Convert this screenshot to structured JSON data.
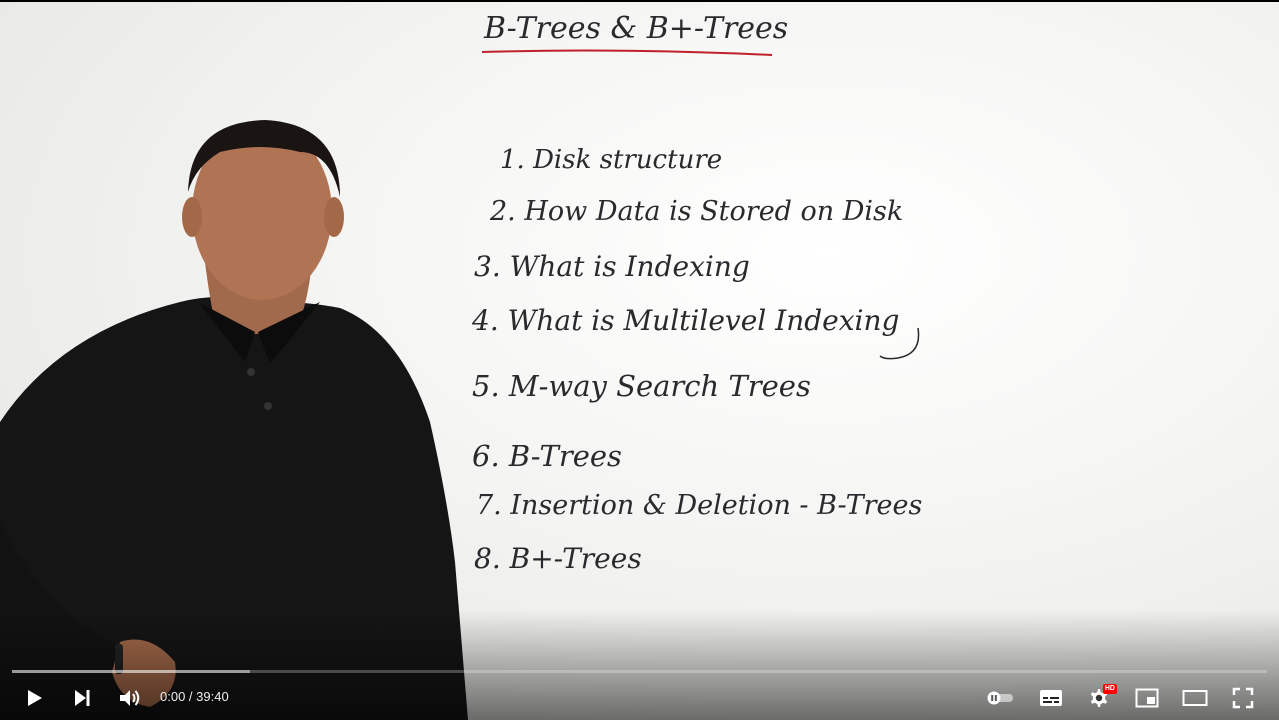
{
  "whiteboard": {
    "title": "B-Trees & B+-Trees",
    "items": [
      "1. Disk structure",
      "2. How Data is Stored on Disk",
      "3. What is Indexing",
      "4. What is Multilevel Indexing",
      "5. M-way Search Trees",
      "6. B-Trees",
      "7. Insertion & Deletion - B-Trees",
      "8. B+-Trees"
    ]
  },
  "player": {
    "current_time": "0:00",
    "separator": " / ",
    "duration": "39:40",
    "hd_badge": "HD",
    "progress_played": 0.0,
    "progress_loaded": 0.19,
    "autoplay_state": "off",
    "accent_color": "#ff0000"
  },
  "controls": {
    "icons": [
      "play-icon",
      "next-icon",
      "volume-icon",
      "autoplay-toggle-icon",
      "subtitles-icon",
      "settings-icon",
      "miniplayer-icon",
      "theater-mode-icon",
      "fullscreen-icon"
    ]
  }
}
